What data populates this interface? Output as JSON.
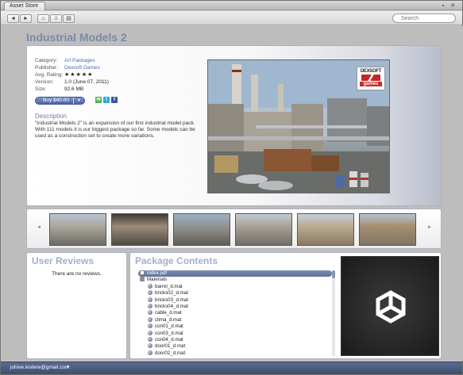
{
  "window": {
    "tab_title": "Asset Store"
  },
  "toolbar": {
    "back_icon": "◄",
    "forward_icon": "►",
    "home_icon": "⌂",
    "download_icon": "⇩",
    "list_icon": "▤",
    "search_placeholder": "Search"
  },
  "package": {
    "title": "Industrial Models 2",
    "meta": [
      {
        "key": "Category:",
        "value": "Art Packages",
        "link": true
      },
      {
        "key": "Publisher:",
        "value": "Dexsoft Games",
        "link": true
      },
      {
        "key": "Avg. Rating:",
        "value": "★★★★★",
        "link": false
      },
      {
        "key": "Version:",
        "value": "1.0 (June 07, 2011)",
        "link": false
      },
      {
        "key": "Size:",
        "value": "92.6 MB",
        "link": false
      }
    ],
    "rating_stars": 0,
    "buy_label": "Buy $40.00",
    "description_heading": "Description",
    "description": "\"Industrial Models 2\" is an expansion of our first industrial model pack. With 111 models it is our biggest package so far. Some models can be used as a construction set to create more variations.",
    "logo": {
      "top": "DEXSOFT",
      "bottom": "games"
    }
  },
  "reviews": {
    "heading": "User Reviews",
    "empty_text": "There are no reviews."
  },
  "contents": {
    "heading": "Package Contents",
    "files": [
      {
        "name": "index.pdf",
        "type": "doc",
        "selected": true,
        "indent": 0
      },
      {
        "name": "Materials",
        "type": "folder",
        "selected": false,
        "indent": 0
      },
      {
        "name": "barrel_d.mat",
        "type": "mat",
        "selected": false,
        "indent": 1
      },
      {
        "name": "bricks02_d.mat",
        "type": "mat",
        "selected": false,
        "indent": 1
      },
      {
        "name": "bricks03_d.mat",
        "type": "mat",
        "selected": false,
        "indent": 1
      },
      {
        "name": "bricks04_d.mat",
        "type": "mat",
        "selected": false,
        "indent": 1
      },
      {
        "name": "cable_d.mat",
        "type": "mat",
        "selected": false,
        "indent": 1
      },
      {
        "name": "clima_d.mat",
        "type": "mat",
        "selected": false,
        "indent": 1
      },
      {
        "name": "con01_d.mat",
        "type": "mat",
        "selected": false,
        "indent": 1
      },
      {
        "name": "con03_d.mat",
        "type": "mat",
        "selected": false,
        "indent": 1
      },
      {
        "name": "con04_d.mat",
        "type": "mat",
        "selected": false,
        "indent": 1
      },
      {
        "name": "door01_d.mat",
        "type": "mat",
        "selected": false,
        "indent": 1
      },
      {
        "name": "door02_d.mat",
        "type": "mat",
        "selected": false,
        "indent": 1
      }
    ]
  },
  "status": {
    "user": "johive.lestere@gmail.com"
  }
}
